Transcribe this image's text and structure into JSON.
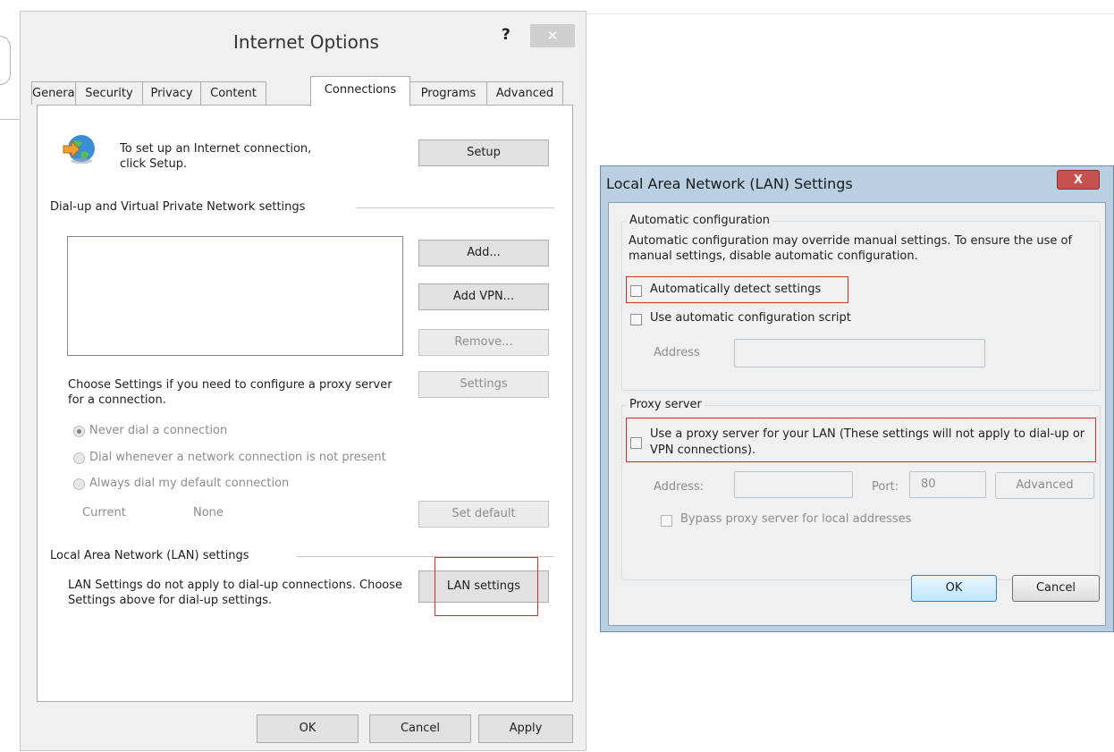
{
  "internet_options": {
    "title": "Internet Options",
    "help_label": "?",
    "close_label": "✕",
    "tabs": [
      "General",
      "Security",
      "Privacy",
      "Content",
      "Connections",
      "Programs",
      "Advanced"
    ],
    "active_tab": "Connections",
    "setup_text": "To set up an Internet connection, click Setup.",
    "setup_button": "Setup",
    "dialup_header": "Dial-up and Virtual Private Network settings",
    "add_button": "Add...",
    "add_vpn_button": "Add VPN...",
    "remove_button": "Remove...",
    "proxy_text": "Choose Settings if you need to configure a proxy server for a connection.",
    "settings_button": "Settings",
    "radio_options": [
      "Never dial a connection",
      "Dial whenever a network connection is not present",
      "Always dial my default connection"
    ],
    "radio_selected": 0,
    "current_label": "Current",
    "current_value": "None",
    "set_default_button": "Set default",
    "lan_header": "Local Area Network (LAN) settings",
    "lan_text": "LAN Settings do not apply to dial-up connections. Choose Settings above for dial-up settings.",
    "lan_settings_button": "LAN settings",
    "ok_button": "OK",
    "cancel_button": "Cancel",
    "apply_button": "Apply"
  },
  "lan_dialog": {
    "title": "Local Area Network (LAN) Settings",
    "close_label": "X",
    "auto_config_title": "Automatic configuration",
    "auto_config_text": "Automatic configuration may override manual settings.  To ensure the use of manual settings, disable automatic configuration.",
    "auto_detect_label": "Automatically detect settings",
    "auto_detect_checked": false,
    "auto_script_label": "Use automatic configuration script",
    "auto_script_checked": false,
    "address_label": "Address",
    "address_value": "",
    "proxy_title": "Proxy server",
    "use_proxy_label": "Use a proxy server for your LAN (These settings will not apply to dial-up or VPN connections).",
    "use_proxy_checked": false,
    "proxy_address_label": "Address:",
    "proxy_address_value": "",
    "port_label": "Port:",
    "port_value": "80",
    "advanced_button": "Advanced",
    "bypass_label": "Bypass proxy server for local addresses",
    "bypass_checked": false,
    "ok_button": "OK",
    "cancel_button": "Cancel"
  },
  "colors": {
    "highlight_red": "#c83232",
    "lan_titlebar": "#b9cfe2",
    "disabled_text": "#8d8d8d"
  }
}
